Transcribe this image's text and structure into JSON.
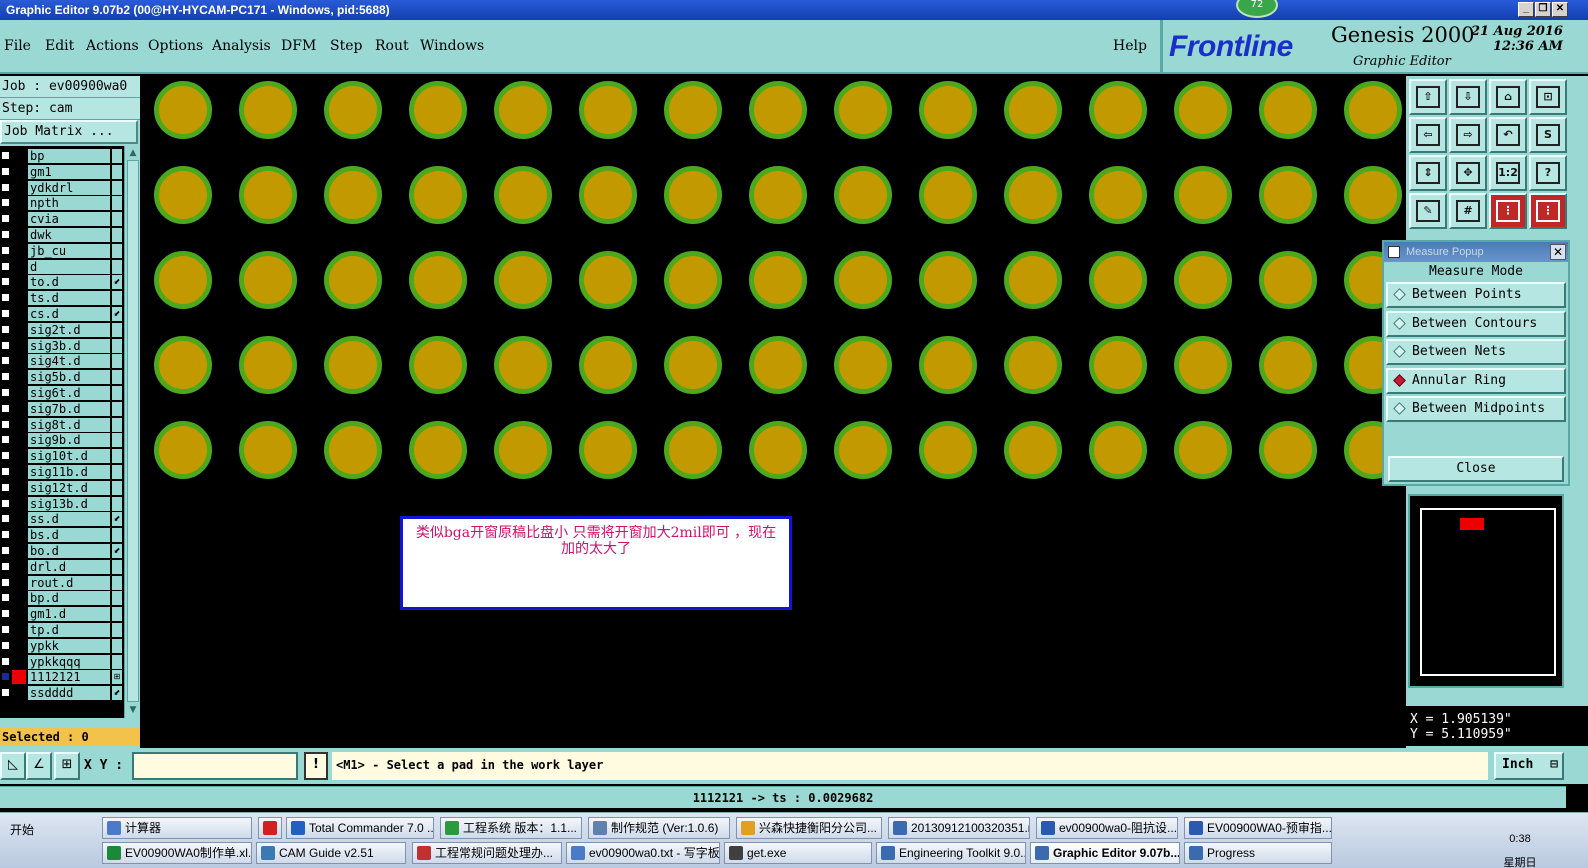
{
  "window": {
    "title": "Graphic Editor 9.07b2 (00@HY-HYCAM-PC171 - Windows, pid:5688)",
    "badge": "72"
  },
  "menu": {
    "items": [
      "File",
      "Edit",
      "Actions",
      "Options",
      "Analysis",
      "DFM",
      "Step",
      "Rout",
      "Windows"
    ],
    "help": "Help"
  },
  "brand": {
    "logo": "Frontline",
    "product": "Genesis 2000",
    "subtitle": "Graphic Editor",
    "date": "21 Aug 2016",
    "time": "12:36 AM"
  },
  "left_panel": {
    "job": "Job : ev00900wa0",
    "step": "Step: cam",
    "job_matrix": "Job Matrix ...",
    "layers": [
      {
        "name": "bp"
      },
      {
        "name": "gm1"
      },
      {
        "name": "ydkdrl"
      },
      {
        "name": "npth"
      },
      {
        "name": "cvia"
      },
      {
        "name": "dwk"
      },
      {
        "name": "jb_cu"
      },
      {
        "name": "d"
      },
      {
        "name": "to.d",
        "mark": "⬋"
      },
      {
        "name": "ts.d"
      },
      {
        "name": "cs.d",
        "mark": "⬋"
      },
      {
        "name": "sig2t.d"
      },
      {
        "name": "sig3b.d"
      },
      {
        "name": "sig4t.d"
      },
      {
        "name": "sig5b.d"
      },
      {
        "name": "sig6t.d"
      },
      {
        "name": "sig7b.d"
      },
      {
        "name": "sig8t.d"
      },
      {
        "name": "sig9b.d"
      },
      {
        "name": "sig10t.d"
      },
      {
        "name": "sig11b.d"
      },
      {
        "name": "sig12t.d"
      },
      {
        "name": "sig13b.d"
      },
      {
        "name": "ss.d",
        "mark": "⬋"
      },
      {
        "name": "bs.d"
      },
      {
        "name": "bo.d",
        "mark": "⬋"
      },
      {
        "name": "drl.d"
      },
      {
        "name": "rout.d"
      },
      {
        "name": "bp.d"
      },
      {
        "name": "gm1.d"
      },
      {
        "name": "tp.d"
      },
      {
        "name": "ypkk"
      },
      {
        "name": "ypkkqqq"
      },
      {
        "name": "1112121",
        "mark": "⊞",
        "active": true
      },
      {
        "name": "ssdddd",
        "mark": "⬋"
      }
    ],
    "selected": "Selected : 0"
  },
  "canvas": {
    "pad_rows": 5,
    "pad_cols": 15,
    "colors": {
      "pad_fill": "#c29a00",
      "pad_ring": "#4ca81c",
      "background": "#000000"
    },
    "note": "类似bga开窗原稿比盘小  只需将开窗加大2mil即可  ，现在加的太大了"
  },
  "toolbar": {
    "buttons": [
      {
        "name": "layer-up-icon",
        "glyph": "⇧"
      },
      {
        "name": "layer-down-icon",
        "glyph": "⇩"
      },
      {
        "name": "home-icon",
        "glyph": "⌂"
      },
      {
        "name": "zoom-window-icon",
        "glyph": "⊡"
      },
      {
        "name": "pan-left-icon",
        "glyph": "⇦"
      },
      {
        "name": "pan-right-icon",
        "glyph": "⇨"
      },
      {
        "name": "undo-zoom-icon",
        "glyph": "↶"
      },
      {
        "name": "redraw-icon",
        "glyph": "S"
      },
      {
        "name": "fit-vertical-icon",
        "glyph": "⇕"
      },
      {
        "name": "center-icon",
        "glyph": "✥"
      },
      {
        "name": "scale-icon",
        "glyph": "1:2"
      },
      {
        "name": "help-icon",
        "glyph": "?"
      },
      {
        "name": "measure-icon",
        "glyph": "✎"
      },
      {
        "name": "grid-icon",
        "glyph": "#"
      },
      {
        "name": "net-icon",
        "glyph": "⋮"
      },
      {
        "name": "net2-icon",
        "glyph": "⋮"
      }
    ]
  },
  "measure": {
    "title": "Measure Popup",
    "header": "Measure Mode",
    "options": [
      "Between Points",
      "Between Contours",
      "Between Nets",
      "Annular Ring",
      "Between Midpoints"
    ],
    "selected": "Annular Ring",
    "close": "Close"
  },
  "coords": {
    "x": "X = 1.905139\"",
    "y": "Y = 5.110959\""
  },
  "command": {
    "xy_label": "X Y :",
    "xy_value": "",
    "excl": "!",
    "prompt": "<M1> - Select a pad in the work layer",
    "unit": "Inch"
  },
  "status": "1112121 -> ts : 0.0029682",
  "taskbar": {
    "start": "开始",
    "row1": [
      {
        "label": "计算器",
        "color": "#4a7ac8"
      },
      {
        "label": "",
        "color": "#d02020"
      },
      {
        "label": "Total Commander 7.0 ...",
        "color": "#2060c0"
      },
      {
        "label": "工程系统  版本：1.1...",
        "color": "#2a9a3a"
      },
      {
        "label": "制作规范 (Ver:1.0.6)",
        "color": "#6080b0"
      },
      {
        "label": "兴森快捷衡阳分公司...",
        "color": "#e0a020"
      },
      {
        "label": "20130912100320351.r...",
        "color": "#3a6ab0"
      },
      {
        "label": "ev00900wa0-阻抗设...",
        "color": "#2a5ab0"
      },
      {
        "label": "EV00900WA0-预审指...",
        "color": "#2a5ab0"
      }
    ],
    "row2": [
      {
        "label": "EV00900WA0制作单.xl...",
        "color": "#1a8a3a"
      },
      {
        "label": "CAM  Guide v2.51",
        "color": "#3a7ab0"
      },
      {
        "label": "工程常规问题处理办...",
        "color": "#c03030"
      },
      {
        "label": "ev00900wa0.txt - 写字板",
        "color": "#4a7ac8"
      },
      {
        "label": "get.exe",
        "color": "#404040"
      },
      {
        "label": "Engineering Toolkit 9.0...",
        "color": "#3a6ab0"
      },
      {
        "label": "Graphic Editor 9.07b...",
        "color": "#3a6ab0",
        "active": true
      },
      {
        "label": "Progress",
        "color": "#3a6ab0"
      }
    ],
    "clock_time": "0:38",
    "clock_day": "星期日"
  }
}
